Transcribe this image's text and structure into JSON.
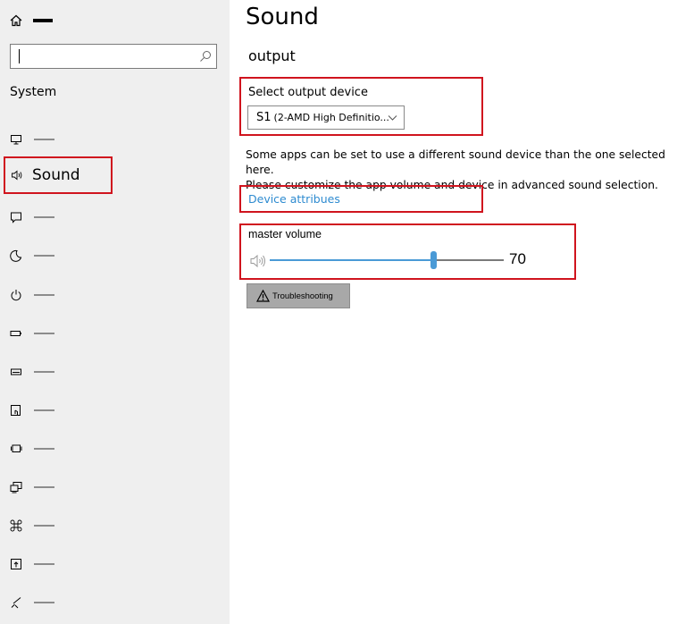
{
  "sidebar": {
    "section_title": "System",
    "active_item": {
      "label": "Sound",
      "icon": "speaker-icon"
    },
    "items": [
      {
        "icon": "display-icon"
      },
      {
        "icon": "notification-icon"
      },
      {
        "icon": "moon-icon"
      },
      {
        "icon": "power-icon"
      },
      {
        "icon": "battery-icon"
      },
      {
        "icon": "storage-icon"
      },
      {
        "icon": "tablet-icon"
      },
      {
        "icon": "multitasking-icon"
      },
      {
        "icon": "projecting-icon"
      },
      {
        "icon": "shared-experiences-icon"
      },
      {
        "icon": "clipboard-icon"
      },
      {
        "icon": "remote-desktop-icon"
      }
    ]
  },
  "main": {
    "title": "Sound",
    "output_title": "output",
    "output_device": {
      "label": "Select output device",
      "selected_prefix": "S1",
      "selected_value": "(2-AMD High Definitio..."
    },
    "description_line1": "Some apps can be set to use a different sound device than the one selected here.",
    "description_line2": "Please customize the app volume and device in advanced sound selection.",
    "device_link": "Device attribues",
    "volume": {
      "label": "master volume",
      "value": "70",
      "level": 70
    },
    "troubleshoot_label": "Troubleshooting"
  },
  "colors": {
    "accent": "#4a9ad6",
    "link": "#2e8bd0",
    "highlight": "#d0141e"
  }
}
